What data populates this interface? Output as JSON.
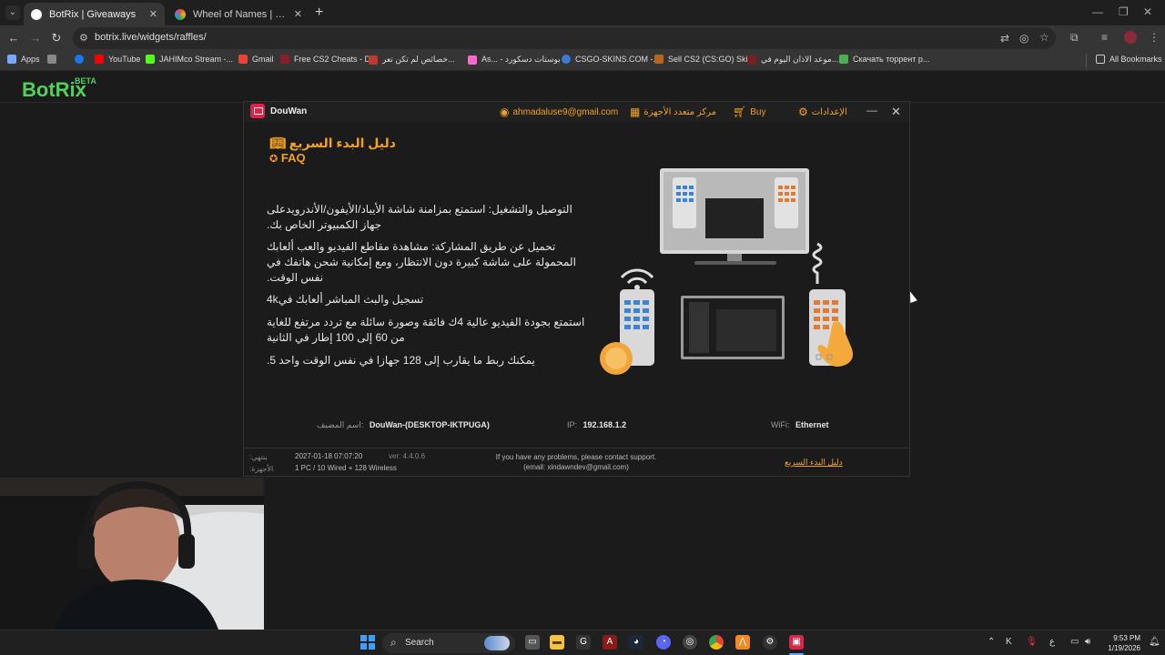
{
  "browser": {
    "tabs": [
      {
        "title": "BotRix | Giveaways",
        "active": true,
        "favicon_color": "#ffffff"
      },
      {
        "title": "Wheel of Names | اسم العشوائي",
        "active": false,
        "favicon_color": "#e94e3b"
      }
    ],
    "url": "botrix.live/widgets/raffles/",
    "bookmarks": [
      {
        "label": "Apps",
        "color": "#7aa7ff"
      },
      {
        "label": "",
        "color": "#999999"
      },
      {
        "label": "",
        "color": "#1877f2"
      },
      {
        "label": "YouTube",
        "color": "#ff0000"
      },
      {
        "label": "JAHIMco Stream -...",
        "color": "#53fc18"
      },
      {
        "label": "Gmail",
        "color": "#ea4335"
      },
      {
        "label": "Free CS2 Cheats - D...",
        "color": "#8b1e2d"
      },
      {
        "label": "خصائص لم تكن تعر...",
        "color": "#c0392b"
      },
      {
        "label": "As... - بوستات دسكورد",
        "color": "#ff6bcb"
      },
      {
        "label": "CSGO-SKINS.COM -...",
        "color": "#3a7bd5"
      },
      {
        "label": "Sell CS2 (CS:GO) Ski...",
        "color": "#b5651d"
      },
      {
        "label": "موعد الاذان اليوم في...",
        "color": "#7b1e1e"
      },
      {
        "label": "Скачать торрент р...",
        "color": "#4caf50"
      },
      {
        "label": "All Bookmarks",
        "color": "#cccccc"
      }
    ]
  },
  "page": {
    "logo": "BotRix",
    "beta": "BETA"
  },
  "douwan": {
    "title": "DouWan",
    "account": "ahmadaluse9@gmail.com",
    "multi_device": "مركز متعدد الأجهزة",
    "buy": "Buy",
    "settings": "الإعدادات",
    "quick_guide": "دليل البدء السريع",
    "faq": "FAQ",
    "features": [
      "التوصيل والتشغيل: استمتع بمزامنة شاشة الأيباد/الأيفون/الأندرويدعلى جهاز الكمبيوتر الخاص بك.",
      "تحميل عن طريق المشاركة: مشاهدة مقاطع الفيديو والعب ألعابك المحمولة على شاشة كبيرة دون الانتظار، ومع إمكانية شحن هاتفك في نفس الوقت.",
      "تسجيل والبث المباشر ألعابك في4k",
      "استمتع بجودة الفيديو عالية 4ك فائقة وصورة سائلة مع تردد مرتفع للغاية من 60 إلى 100 إطار في الثانية",
      "يمكنك ربط ما يقارب إلى 128 جهازا في نفس الوقت واحد 5."
    ],
    "host_label": "اسم المضيف:",
    "host_value": "DouWan-(DESKTOP-IKTPUGA)",
    "ip_label": "IP:",
    "ip_value": "192.168.1.2",
    "wifi_label": "WiFi:",
    "wifi_value": "Ethernet",
    "footer": {
      "expiry_label": "ينتهي: الأجهزة:",
      "expiry_value": "2027-01-18 07:07:20",
      "version": "ver: 4.4.0.6",
      "devices": "1 PC / 10 Wired + 128 Wireless",
      "support_line1": "If you have any problems, please contact support.",
      "support_line2": "(email: xindawndev@gmail.com)",
      "guide_link": "دليل البدء السريع"
    }
  },
  "taskbar": {
    "search": "Search",
    "time": "9:53 PM",
    "date": "1/19/2026",
    "lang": "ع"
  }
}
